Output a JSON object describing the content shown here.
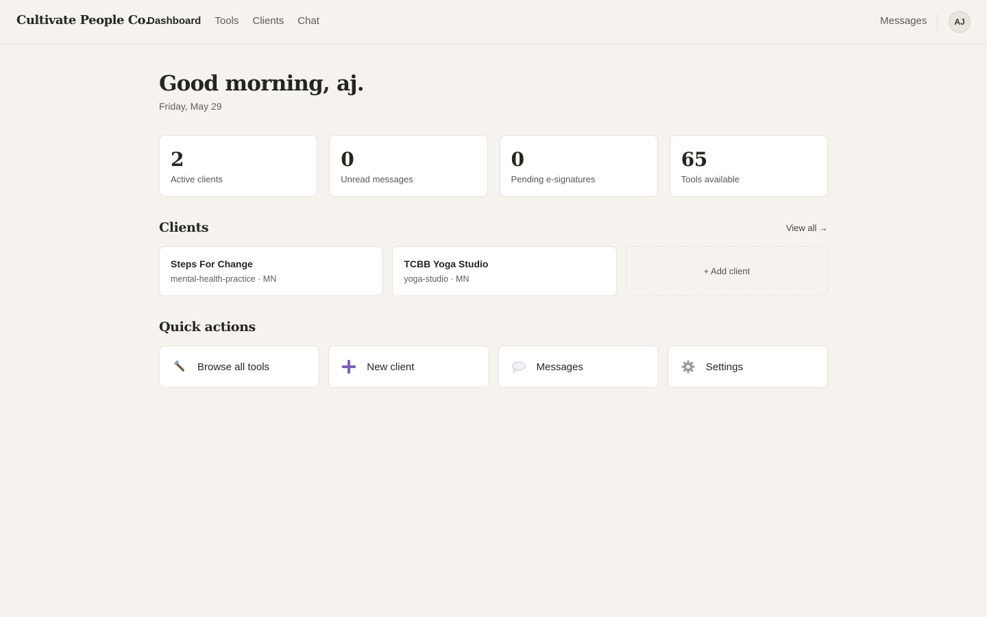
{
  "header": {
    "brand": "Cultivate People Co.",
    "nav": [
      "Dashboard",
      "Tools",
      "Clients",
      "Chat"
    ],
    "active_nav": "Dashboard",
    "messages_link": "Messages",
    "avatar_initials": "AJ"
  },
  "greeting": {
    "title": "Good morning, aj.",
    "date": "Friday, May 29"
  },
  "stats": [
    {
      "value": "2",
      "label": "Active clients"
    },
    {
      "value": "0",
      "label": "Unread messages"
    },
    {
      "value": "0",
      "label": "Pending e-signatures"
    },
    {
      "value": "65",
      "label": "Tools available"
    }
  ],
  "clients_section": {
    "title": "Clients",
    "view_all": "View all →",
    "items": [
      {
        "name": "Steps For Change",
        "meta": "mental-health-practice · MN"
      },
      {
        "name": "TCBB Yoga Studio",
        "meta": "yoga-studio · MN"
      }
    ],
    "add_label": "+ Add client"
  },
  "quick_actions": {
    "title": "Quick actions",
    "items": [
      {
        "label": "Browse all tools",
        "icon": "tools-icon"
      },
      {
        "label": "New client",
        "icon": "plus-icon"
      },
      {
        "label": "Messages",
        "icon": "chat-bubble-icon"
      },
      {
        "label": "Settings",
        "icon": "gear-icon"
      }
    ]
  },
  "colors": {
    "background": "#f6f3ee",
    "card": "#ffffff",
    "border": "#e6e1d9",
    "heading": "#23271f",
    "accent_plus": "#7b5fb8"
  }
}
